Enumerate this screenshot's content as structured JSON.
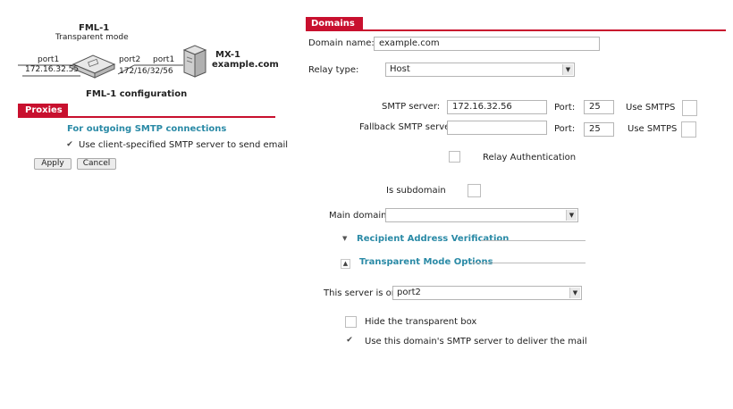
{
  "left": {
    "diagram": {
      "fml_name": "FML-1",
      "fml_mode": "Transparent mode",
      "port1_left": "port1",
      "port2": "port2",
      "port1_right": "port1",
      "ip_left": "172.16.32.55",
      "ip_right": "172/16/32/56",
      "mx_name": "MX-1",
      "mx_domain": "example.com",
      "caption": "FML-1 configuration"
    },
    "tab": "Proxies",
    "section_title": "For outgoing SMTP connections",
    "checkbox_label": "Use client-specified SMTP server to send email",
    "checkbox_checked": true,
    "apply_label": "Apply",
    "cancel_label": "Cancel"
  },
  "right": {
    "tab": "Domains",
    "domain_name_label": "Domain name:",
    "domain_name_value": "example.com",
    "relay_type_label": "Relay type:",
    "relay_type_value": "Host",
    "smtp_server_label": "SMTP server:",
    "smtp_server_value": "172.16.32.56",
    "port_label": "Port:",
    "port_value": "25",
    "use_smtps_label": "Use SMTPS",
    "fallback_label": "Fallback SMTP server:",
    "fallback_value": "",
    "fallback_port_label": "Port:",
    "fallback_port_value": "25",
    "fallback_smtps_label": "Use SMTPS",
    "relay_auth_label": "Relay Authentication",
    "is_subdomain_label": "Is subdomain",
    "main_domain_label": "Main domain:",
    "main_domain_value": "",
    "recipient_verif_label": "Recipient Address Verification",
    "transparent_opts_label": "Transparent Mode Options",
    "this_server_label": "This server is on",
    "this_server_value": "port2",
    "hide_box_label": "Hide the transparent box",
    "use_domain_smtp_label": "Use this domain's SMTP server to deliver the mail",
    "use_domain_smtp_checked": true
  },
  "colors": {
    "accent_red": "#c8102e",
    "link_teal": "#2a8aa6"
  }
}
